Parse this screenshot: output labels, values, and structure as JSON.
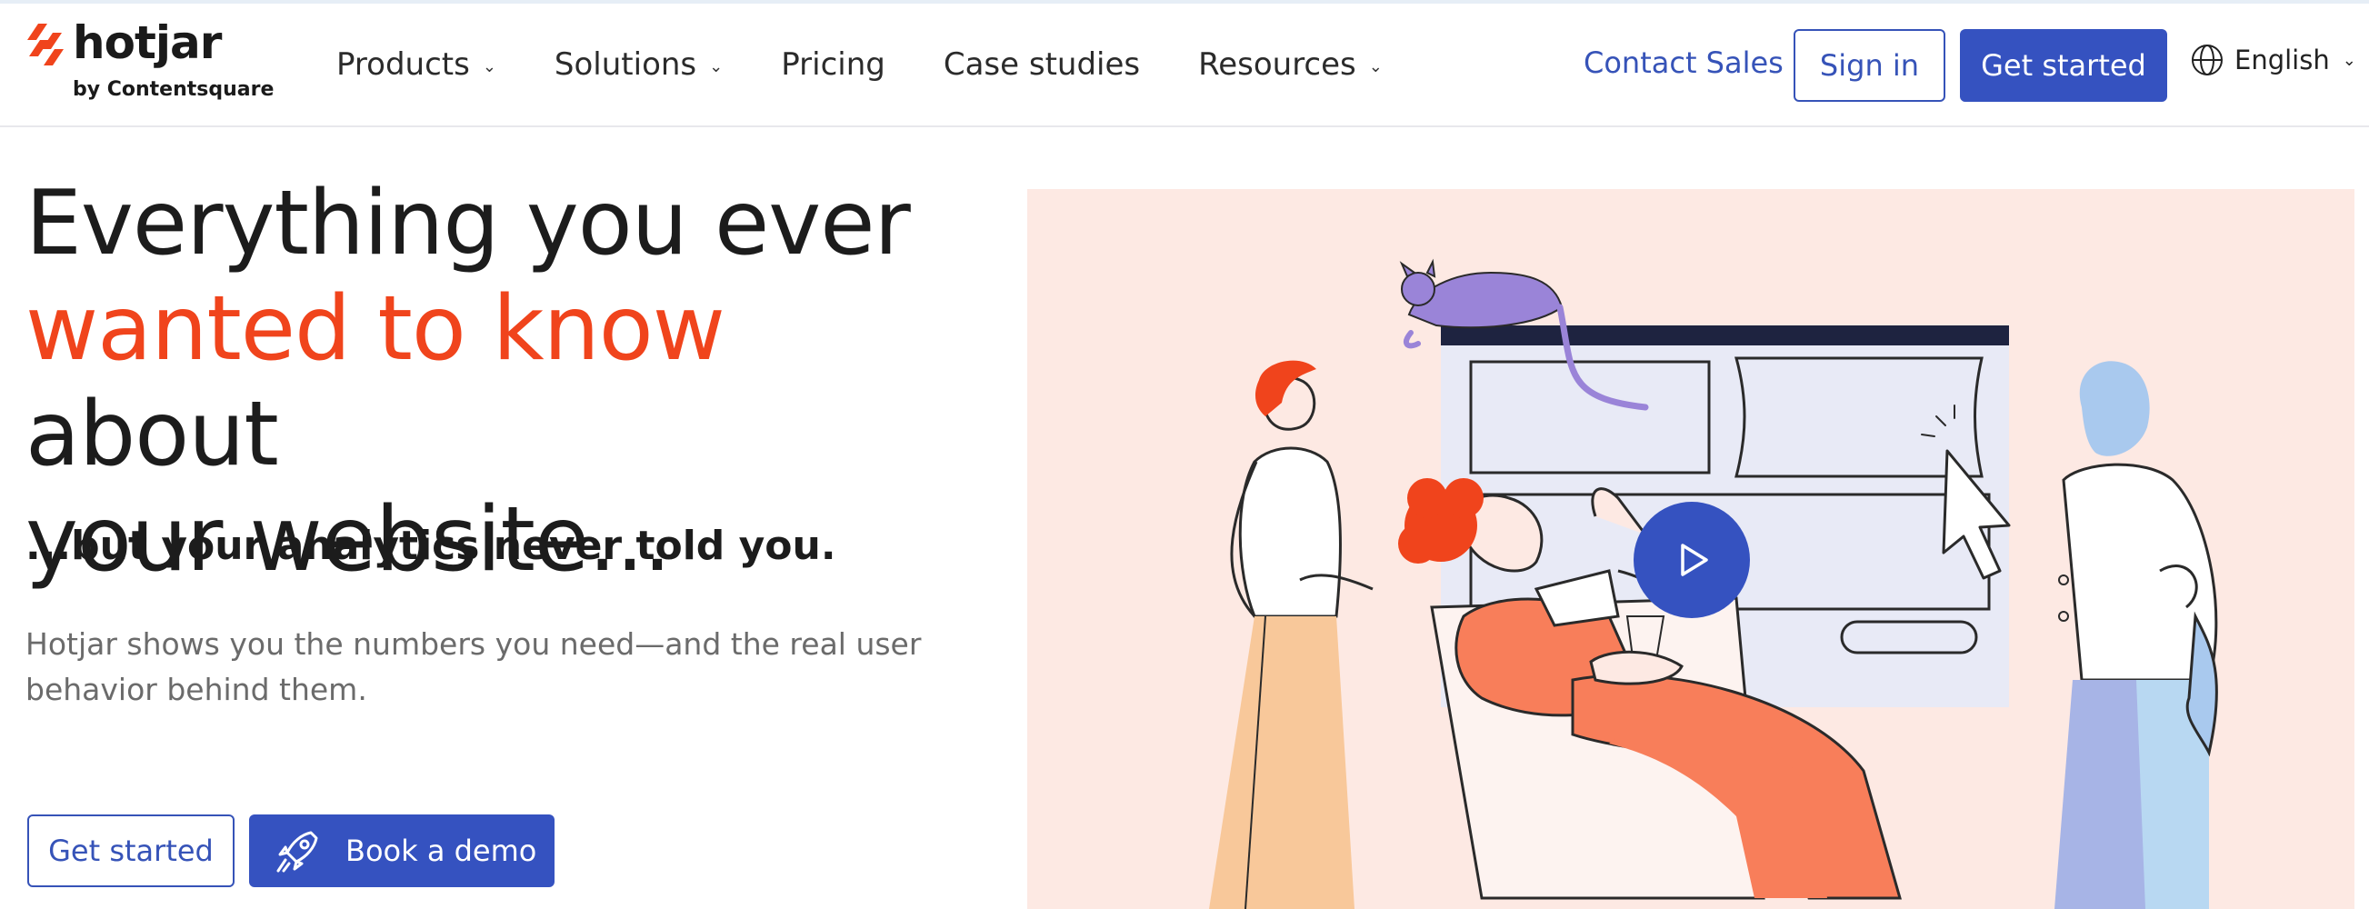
{
  "header": {
    "logo": {
      "word": "hotjar",
      "sub": "by Contentsquare"
    },
    "nav": [
      {
        "label": "Products",
        "has_dropdown": true
      },
      {
        "label": "Solutions",
        "has_dropdown": true
      },
      {
        "label": "Pricing",
        "has_dropdown": false
      },
      {
        "label": "Case studies",
        "has_dropdown": false
      },
      {
        "label": "Resources",
        "has_dropdown": true
      }
    ],
    "contact_sales": "Contact Sales",
    "sign_in": "Sign in",
    "get_started": "Get started",
    "language": "English"
  },
  "hero": {
    "headline_line1": "Everything you ever",
    "headline_accent": "wanted to know",
    "headline_after_accent": " about",
    "headline_line3": "your website...",
    "subheadline": "...but your analytics never told you.",
    "description": "Hotjar shows you the numbers you need—and the real user behavior behind them.",
    "get_started": "Get started",
    "book_demo": "Book a demo"
  },
  "colors": {
    "brand_blue": "#3552c0",
    "accent_orange": "#f0441c",
    "illustration_bg": "#fde9e3"
  },
  "icons": {
    "logo": "hotjar-logo-icon",
    "globe": "globe-icon",
    "rocket": "rocket-icon",
    "play": "play-icon",
    "chevron": "chevron-down-icon"
  }
}
